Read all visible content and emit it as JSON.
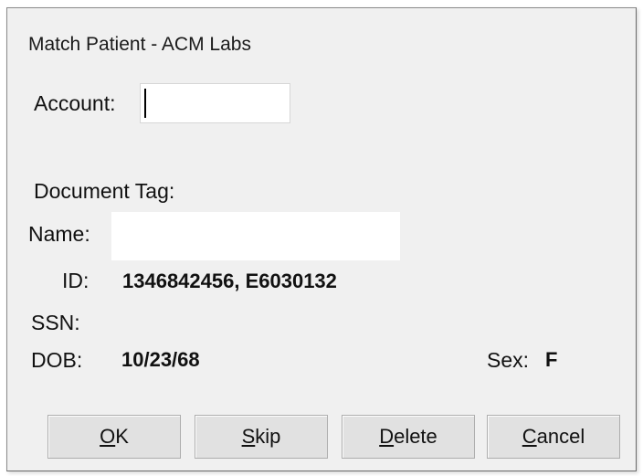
{
  "window": {
    "title": "Match Patient - ACM Labs"
  },
  "account": {
    "label": "Account:",
    "value": ""
  },
  "document_tag": {
    "label": "Document Tag:"
  },
  "name": {
    "label": "Name:",
    "value": ""
  },
  "id": {
    "label": "ID:",
    "value": "1346842456, E6030132"
  },
  "ssn": {
    "label": "SSN:",
    "value": ""
  },
  "dob": {
    "label": "DOB:",
    "value": "10/23/68"
  },
  "sex": {
    "label": "Sex:",
    "value": "F"
  },
  "buttons": {
    "ok": {
      "mnemonic": "O",
      "rest": "K"
    },
    "skip": {
      "mnemonic": "S",
      "rest": "kip"
    },
    "delete": {
      "mnemonic": "D",
      "rest": "elete"
    },
    "cancel": {
      "mnemonic": "C",
      "rest": "ancel"
    }
  }
}
